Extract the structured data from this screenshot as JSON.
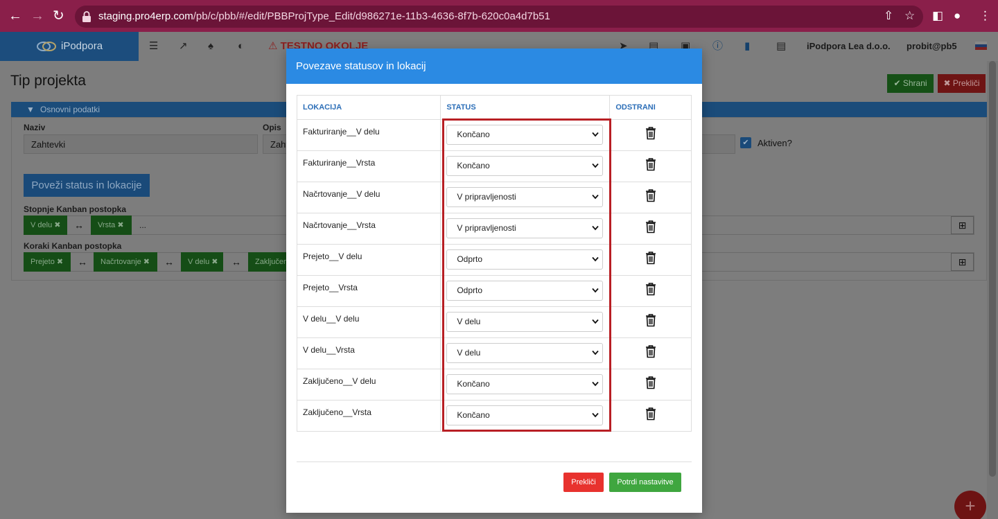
{
  "browser": {
    "url_host": "staging.pro4erp.com",
    "url_path": "/pb/c/pbb/#/edit/PBBProjType_Edit/d986271e-11b3-4636-8f7b-620c0a4d7b51"
  },
  "header": {
    "brand": "iPodpora",
    "environment_warning": "TESTNO OKOLJE",
    "company": "iPodpora Lea d.o.o.",
    "user": "probit@pb5"
  },
  "page": {
    "title": "Tip projekta",
    "save_label": "Shrani",
    "cancel_label": "Prekliči",
    "section_title": "Osnovni podatki",
    "naziv_label": "Naziv",
    "naziv_value": "Zahtevki",
    "opis_label": "Opis",
    "opis_value": "Zaht",
    "aktiven_label": "Aktiven?",
    "link_button": "Poveži status in lokacije",
    "stopnje_label": "Stopnje Kanban postopka",
    "stopnje_tags": [
      "V delu",
      "Vrsta"
    ],
    "stopnje_placeholder": "...",
    "koraki_label": "Koraki Kanban postopka",
    "koraki_tags": [
      "Prejeto",
      "Načrtovanje",
      "V delu",
      "Zaključen"
    ]
  },
  "modal": {
    "title": "Povezave statusov in lokacij",
    "columns": [
      "LOKACIJA",
      "STATUS",
      "ODSTRANI"
    ],
    "rows": [
      {
        "lokacija": "Fakturiranje__V delu",
        "status": "Končano"
      },
      {
        "lokacija": "Fakturiranje__Vrsta",
        "status": "Končano"
      },
      {
        "lokacija": "Načrtovanje__V delu",
        "status": "V pripravljenosti"
      },
      {
        "lokacija": "Načrtovanje__Vrsta",
        "status": "V pripravljenosti"
      },
      {
        "lokacija": "Prejeto__V delu",
        "status": "Odprto"
      },
      {
        "lokacija": "Prejeto__Vrsta",
        "status": "Odprto"
      },
      {
        "lokacija": "V delu__V delu",
        "status": "V delu"
      },
      {
        "lokacija": "V delu__Vrsta",
        "status": "V delu"
      },
      {
        "lokacija": "Zaključeno__V delu",
        "status": "Končano"
      },
      {
        "lokacija": "Zaključeno__Vrsta",
        "status": "Končano"
      }
    ],
    "cancel_label": "Prekliči",
    "confirm_label": "Potrdi nastavitve"
  },
  "colors": {
    "browser_bar": "#8a1f4a",
    "modal_header": "#2b8ae3",
    "highlight": "#b81f24",
    "column_header": "#2d6fb8",
    "confirm_button": "#3fa63f",
    "cancel_button": "#e8322e"
  }
}
